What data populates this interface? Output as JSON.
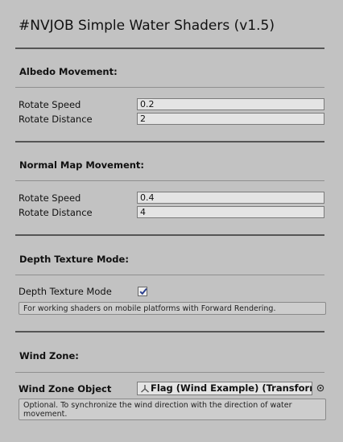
{
  "title": "#NVJOB Simple Water Shaders (v1.5)",
  "albedo": {
    "header": "Albedo Movement:",
    "rotate_speed_label": "Rotate Speed",
    "rotate_speed_value": "0.2",
    "rotate_distance_label": "Rotate Distance",
    "rotate_distance_value": "2"
  },
  "normal": {
    "header": "Normal Map Movement:",
    "rotate_speed_label": "Rotate Speed",
    "rotate_speed_value": "0.4",
    "rotate_distance_label": "Rotate Distance",
    "rotate_distance_value": "4"
  },
  "depth": {
    "header": "Depth Texture Mode:",
    "toggle_label": "Depth Texture Mode",
    "toggle_checked": true,
    "help": "For working shaders on mobile platforms with Forward Rendering."
  },
  "wind": {
    "header": "Wind Zone:",
    "object_label": "Wind Zone Object",
    "object_value": "Flag (Wind Example) (Transform)",
    "object_icon": "transform-icon",
    "help": "Optional. To synchronize the wind direction with the direction of water movement."
  }
}
